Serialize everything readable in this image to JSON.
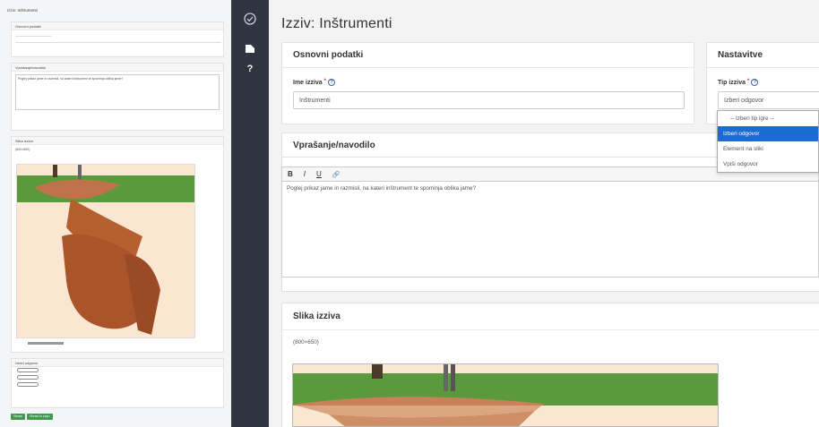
{
  "page_title": "Izziv: Inštrumenti",
  "sidebar": {
    "icons": [
      {
        "name": "check-circle-icon"
      },
      {
        "name": "flag-icon"
      },
      {
        "name": "help-icon",
        "label": "?"
      }
    ]
  },
  "basic": {
    "header": "Osnovni podatki",
    "name_label": "Ime izziva",
    "name_required_mark": "*",
    "name_value": "Inštrumenti"
  },
  "settings": {
    "header": "Nastavitve",
    "type_label": "Tip izziva",
    "type_required_mark": "*",
    "type_value": "Izberi odgovor",
    "options": [
      {
        "label": "-- Izberi tip igre --",
        "selected": false
      },
      {
        "label": "Izberi odgovor",
        "selected": true
      },
      {
        "label": "Element na sliki",
        "selected": false
      },
      {
        "label": "Vpiši odgovor",
        "selected": false
      }
    ]
  },
  "question": {
    "header": "Vprašanje/navodilo",
    "toolbar": {
      "bold": "B",
      "italic": "I",
      "underline": "U",
      "link": "🔗"
    },
    "text": "Poglej prikaz jame in razmisli, na kateri inštrument te spominja oblika jame?"
  },
  "image_section": {
    "header": "Slika izziva",
    "size_note": "(800×650)"
  },
  "preview_panel": {
    "title": "Izziv: Inštrumenti",
    "basic_header": "Osnovni podatki",
    "question_header": "Vprašanje/navodilo",
    "question_text": "Poglej prikaz jame in razmisli, na kateri inštrument te spominja oblika jame?",
    "image_header": "Slika izziva",
    "image_size": "(800×650)",
    "answers_header": "Izberi odgovor",
    "buttons": [
      "Shrani",
      "Shrani in zapri"
    ]
  },
  "colors": {
    "sidebar_bg": "#2f3640",
    "accent": "#1e6bd0",
    "grass": "#5a9a3c",
    "clay": "#b5602f"
  }
}
